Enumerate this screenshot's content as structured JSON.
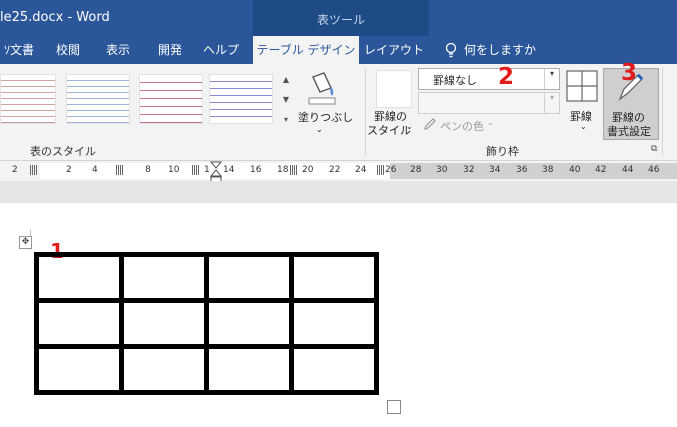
{
  "window": {
    "title": "le25.docx  -  Word",
    "context_tab_group": "表ツール"
  },
  "tabs": [
    {
      "label": "ｿ文書"
    },
    {
      "label": "校閲"
    },
    {
      "label": "表示"
    },
    {
      "label": "開発"
    },
    {
      "label": "ヘルプ"
    },
    {
      "label": "テーブル デザイン"
    },
    {
      "label": "レイアウト"
    },
    {
      "label": "何をしますか"
    }
  ],
  "ribbon": {
    "table_styles": {
      "group_label": "表のスタイル"
    },
    "shading": {
      "label": "塗りつぶし",
      "icon": "paint-bucket-icon"
    },
    "borders_group": {
      "group_label": "飾り枠",
      "border_styles": {
        "line1": "罫線の",
        "line2": "スタイル"
      },
      "line_style_value": "罫線なし",
      "line_weight_value": "",
      "pen_color_label": "ペンの色",
      "borders_button_label": "罫線",
      "border_painter": {
        "line1": "罫線の",
        "line2": "書式設定"
      }
    }
  },
  "annotations": [
    "1",
    "2",
    "3"
  ],
  "ruler": {
    "ticks": [
      "2",
      "2",
      "4",
      "8",
      "10",
      "1",
      "14",
      "16",
      "18",
      "20",
      "22",
      "24",
      "26",
      "28",
      "30",
      "32",
      "34",
      "36",
      "38",
      "40",
      "42",
      "44",
      "46"
    ]
  },
  "table": {
    "rows": 3,
    "cols": 4,
    "border_color": "#000000"
  },
  "colors": {
    "accent": "#2b579a",
    "context_header": "#1e4a86",
    "annotation_red": "#e11b1b"
  }
}
